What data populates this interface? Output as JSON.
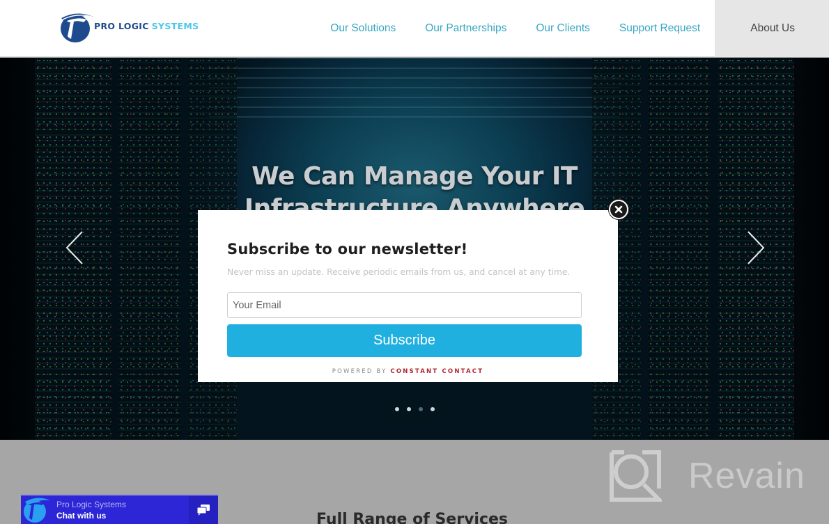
{
  "header": {
    "logo": {
      "brand_primary": "PRO LOGIC",
      "brand_secondary": "SYSTEMS",
      "icon": "pro-logic-logo-icon"
    },
    "nav": [
      {
        "label": "Our Solutions",
        "active": false
      },
      {
        "label": "Our Partnerships",
        "active": false
      },
      {
        "label": "Our Clients",
        "active": false
      },
      {
        "label": "Support Request",
        "active": false
      },
      {
        "label": "About Us",
        "active": true
      }
    ]
  },
  "hero": {
    "title_line1": "We Can Manage Your IT",
    "title_line2": "Infrastructure Anywhere",
    "prev_icon": "chevron-left-icon",
    "next_icon": "chevron-right-icon",
    "slides": {
      "count": 4,
      "active_index": 2
    }
  },
  "modal": {
    "title": "Subscribe to our newsletter!",
    "description": "Never miss an update. Receive periodic emails from us, and cancel at any time.",
    "email": {
      "placeholder": "Your Email",
      "value": ""
    },
    "subscribe_label": "Subscribe",
    "powered_by_prefix": "POWERED BY",
    "powered_by_brand": "CONSTANT CONTACT",
    "close_icon": "close-icon"
  },
  "lower": {
    "section_title": "Full Range of Services",
    "watermark": "Revain"
  },
  "chat": {
    "company": "Pro Logic Systems",
    "cta": "Chat with us",
    "icon": "chat-bubbles-icon"
  },
  "colors": {
    "nav_link": "#38a7c2",
    "nav_active_bg": "#e6e6e6",
    "subscribe_button": "#1fb0e0",
    "constant_contact_brand": "#b0232f",
    "chat_widget": "#2c26d6",
    "logo_dark": "#1e4a8e",
    "logo_light": "#4cc6ea"
  }
}
